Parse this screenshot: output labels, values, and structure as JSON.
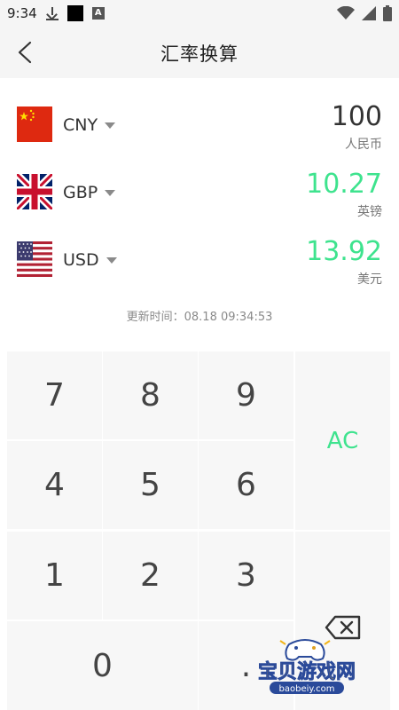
{
  "status_bar": {
    "time": "9:34"
  },
  "header": {
    "title": "汇率换算"
  },
  "currencies": [
    {
      "code": "CNY",
      "name": "人民币",
      "amount": "100",
      "amount_color": "#333333"
    },
    {
      "code": "GBP",
      "name": "英镑",
      "amount": "10.27",
      "amount_color": "#3ee38e"
    },
    {
      "code": "USD",
      "name": "美元",
      "amount": "13.92",
      "amount_color": "#3ee38e"
    }
  ],
  "updated": "更新时间：08.18 09:34:53",
  "keypad": {
    "keys": [
      "7",
      "8",
      "9",
      "4",
      "5",
      "6",
      "1",
      "2",
      "3",
      "0",
      "."
    ],
    "ac_label": "AC",
    "accent_color": "#3ee38e"
  },
  "watermark": {
    "title": "宝贝游戏网",
    "url": "baobeiy.com"
  }
}
